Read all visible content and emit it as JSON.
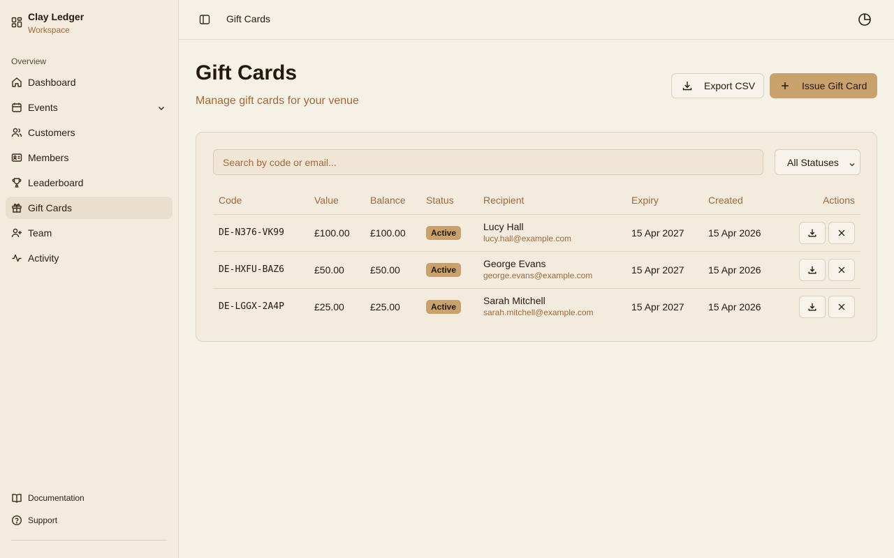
{
  "brand": {
    "name": "Clay Ledger",
    "sub": "Workspace"
  },
  "sidebar": {
    "section_label": "Overview",
    "items": [
      {
        "label": "Dashboard",
        "icon": "home-icon"
      },
      {
        "label": "Events",
        "icon": "calendar-icon"
      },
      {
        "label": "Customers",
        "icon": "users-icon"
      },
      {
        "label": "Members",
        "icon": "id-card-icon"
      },
      {
        "label": "Leaderboard",
        "icon": "trophy-icon"
      },
      {
        "label": "Gift Cards",
        "icon": "gift-icon",
        "active": true
      },
      {
        "label": "Team",
        "icon": "user-plus-icon"
      },
      {
        "label": "Activity",
        "icon": "activity-icon"
      }
    ],
    "bottom": [
      {
        "label": "Documentation",
        "icon": "book-icon"
      },
      {
        "label": "Support",
        "icon": "help-circle-icon"
      }
    ]
  },
  "header": {
    "title": "Gift Cards"
  },
  "main": {
    "title": "Gift Cards",
    "subtitle": "Manage gift cards for your venue",
    "export_label": "Export CSV",
    "issue_label": "Issue Gift Card",
    "search_placeholder": "Search by code or email...",
    "status_filter": "All Statuses"
  },
  "table": {
    "columns": [
      "Code",
      "Value",
      "Balance",
      "Status",
      "Recipient",
      "Expiry",
      "Created",
      "Actions"
    ],
    "rows": [
      {
        "code": "DE-N376-VK99",
        "value": "£100.00",
        "balance": "£100.00",
        "status": "Active",
        "name": "Lucy Hall",
        "email": "lucy.hall@example.com",
        "expiry": "15 Apr 2027",
        "created": "15 Apr 2026"
      },
      {
        "code": "DE-HXFU-BAZ6",
        "value": "£50.00",
        "balance": "£50.00",
        "status": "Active",
        "name": "George Evans",
        "email": "george.evans@example.com",
        "expiry": "15 Apr 2027",
        "created": "15 Apr 2026"
      },
      {
        "code": "DE-LGGX-2A4P",
        "value": "£25.00",
        "balance": "£25.00",
        "status": "Active",
        "name": "Sarah Mitchell",
        "email": "sarah.mitchell@example.com",
        "expiry": "15 Apr 2027",
        "created": "15 Apr 2026"
      }
    ]
  },
  "colors": {
    "accent": "#c9a16c",
    "muted_text": "#a0683a",
    "background": "#f6f1e7",
    "sidebar": "#f3ebde"
  }
}
